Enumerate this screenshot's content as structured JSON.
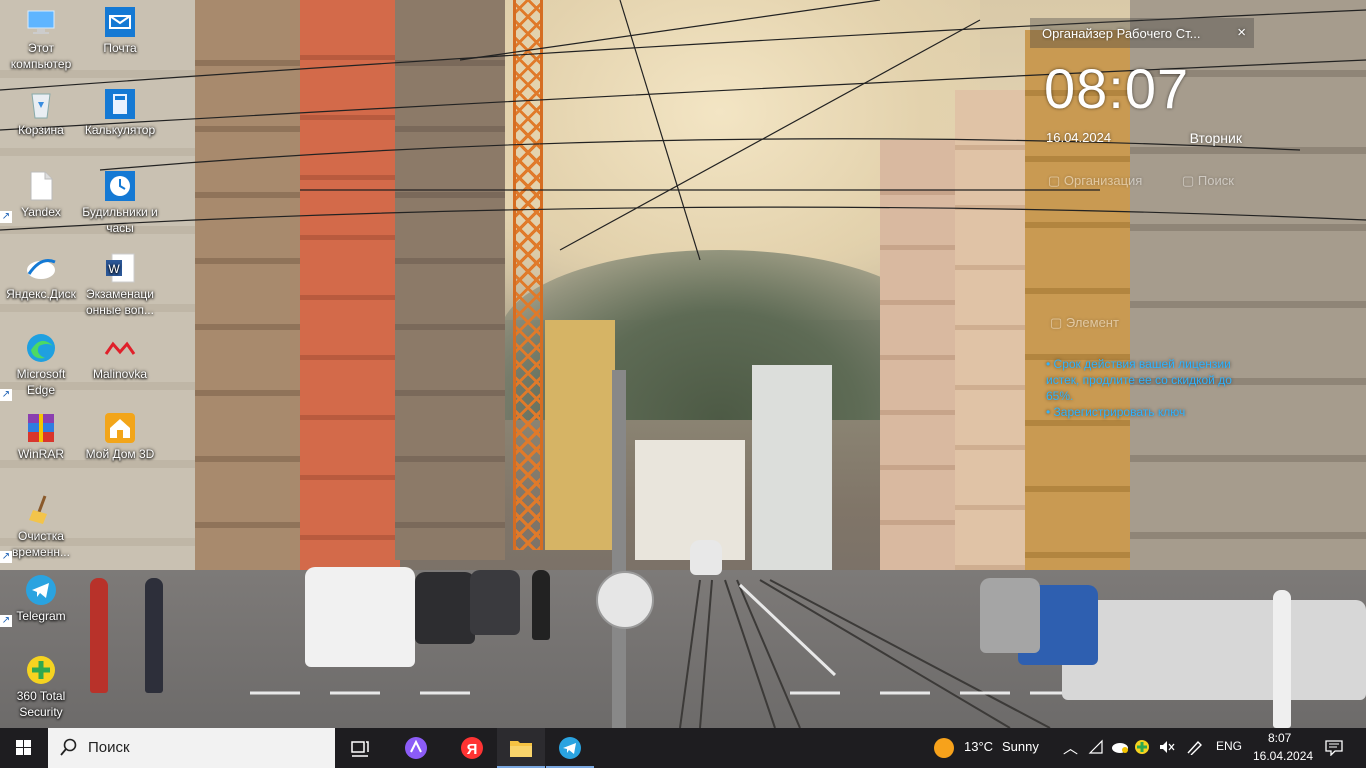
{
  "desktop_icons": [
    {
      "label": "Этот компьютер"
    },
    {
      "label": "Почта"
    },
    {
      "label": "Корзина"
    },
    {
      "label": "Калькулятор"
    },
    {
      "label": "Yandex"
    },
    {
      "label": "Будильники и часы"
    },
    {
      "label": "Яндекс.Диск"
    },
    {
      "label": "Экзаменаци онные воп..."
    },
    {
      "label": "Microsoft Edge"
    },
    {
      "label": "Malinovka"
    },
    {
      "label": "WinRAR"
    },
    {
      "label": "Мой Дом 3D"
    },
    {
      "label": "Очистка временн..."
    },
    {
      "label": "Telegram"
    },
    {
      "label": "360 Total Security"
    }
  ],
  "organizer": {
    "title": "Органайзер Рабочего Ст...",
    "close": "×",
    "time": "08:07",
    "date": "16.04.2024",
    "weekday": "Вторник",
    "tab_organizer": "Организация",
    "tab_search": "Поиск",
    "element": "Элемент",
    "license_expired": "• Срок действия вашей лицензии истек, продлите ее со скидкой до 65%.",
    "register_key": "• Зарегистрировать ключ"
  },
  "taskbar": {
    "search_placeholder": "Поиск",
    "weather_temp": "13°C",
    "weather_text": "Sunny",
    "language": "ENG",
    "time": "8:07",
    "date": "16.04.2024"
  },
  "colors": {
    "taskbar_bg": "#1e1d20",
    "license_link": "#2fb3ff",
    "weather_sun": "#f7a21b"
  }
}
